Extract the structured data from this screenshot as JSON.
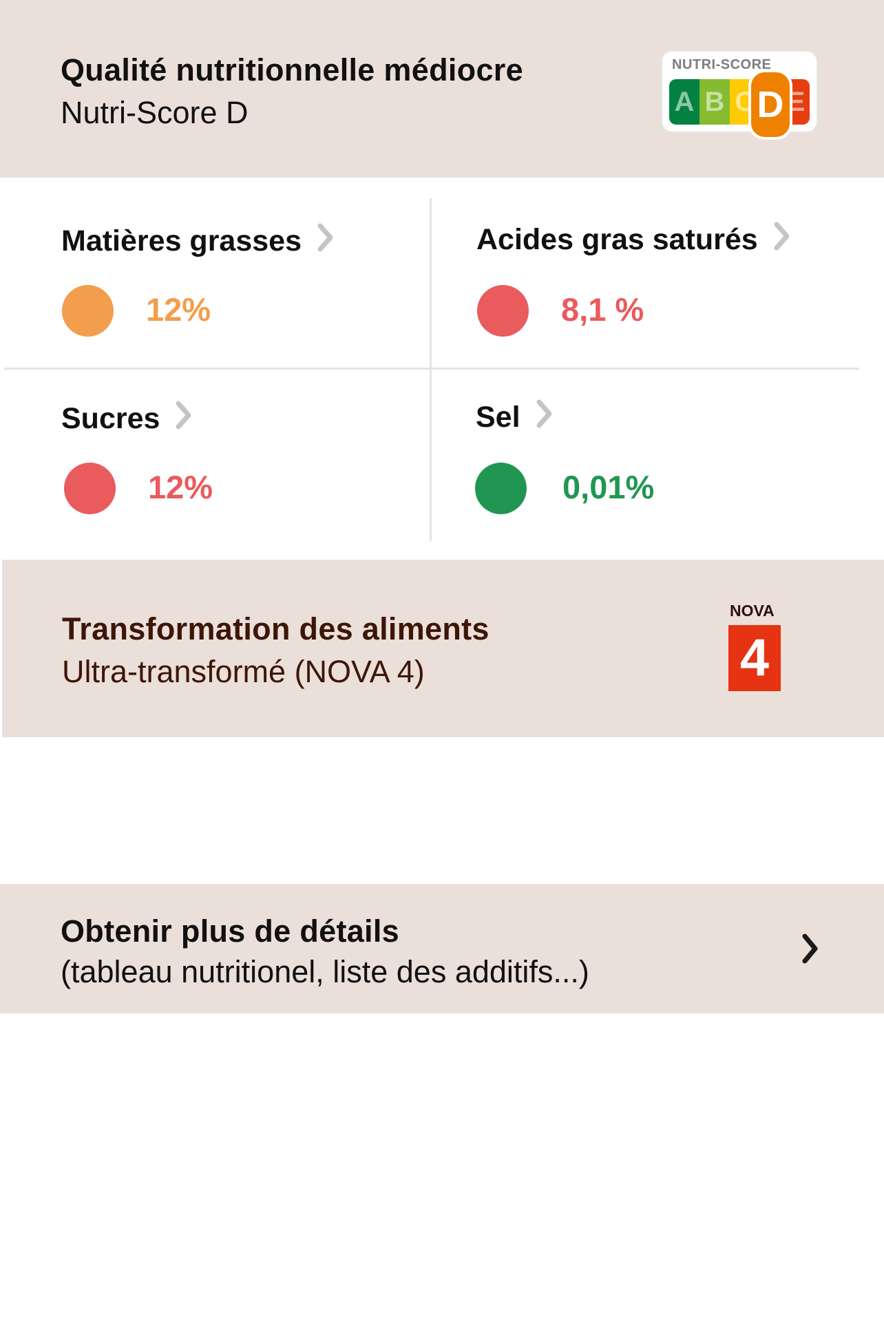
{
  "nutriscore": {
    "title": "Qualité nutritionnelle médiocre",
    "subtitle": "Nutri-Score D",
    "logo_caption": "NUTRI-SCORE",
    "letters": [
      "A",
      "B",
      "C",
      "D",
      "E"
    ],
    "grade": "D"
  },
  "nutrients": [
    {
      "label": "Matières grasses",
      "value": "12%",
      "level_color": "#f29e4c"
    },
    {
      "label": "Acides gras saturés",
      "value": "8,1 %",
      "level_color": "#e95b5d"
    },
    {
      "label": "Sucres",
      "value": "12%",
      "level_color": "#e95b5d"
    },
    {
      "label": "Sel",
      "value": "0,01%",
      "level_color": "#219653"
    }
  ],
  "nova": {
    "title": "Transformation des aliments",
    "subtitle": "Ultra-transformé (NOVA 4)",
    "logo_caption": "NOVA",
    "group": "4"
  },
  "details": {
    "title": "Obtenir plus de détails",
    "subtitle": "(tableau nutritionel, liste des additifs...)"
  },
  "colors": {
    "band_background": "#ebdfda",
    "nova_text": "#3d1607",
    "chevron": "#c4c4c4"
  }
}
